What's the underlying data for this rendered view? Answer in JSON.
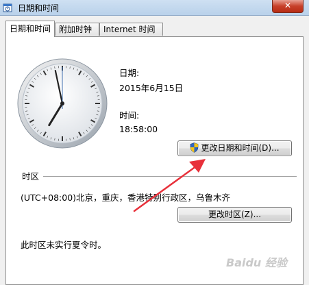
{
  "window": {
    "title": "日期和时间",
    "close_glyph": "✕"
  },
  "tabs": [
    {
      "label": "日期和时间",
      "active": true
    },
    {
      "label": "附加时钟",
      "active": false
    },
    {
      "label": "Internet 时间",
      "active": false
    }
  ],
  "datetime": {
    "date_label": "日期:",
    "date_value": "2015年6月15日",
    "time_label": "时间:",
    "time_value": "18:58:00",
    "change_button": "更改日期和时间(D)..."
  },
  "timezone": {
    "section_label": "时区",
    "value": "(UTC+08:00)北京，重庆，香港特别行政区，乌鲁木齐",
    "change_button": "更改时区(Z)...",
    "dst_note": "此时区未实行夏令时。"
  },
  "watermark": "Baidu 经验",
  "icons": {
    "title": "clock-calendar-icon",
    "shield": "uac-shield-icon",
    "annotation": "red-arrow"
  },
  "colors": {
    "accent": "#1f5fb5",
    "arrow": "#e8303a"
  }
}
